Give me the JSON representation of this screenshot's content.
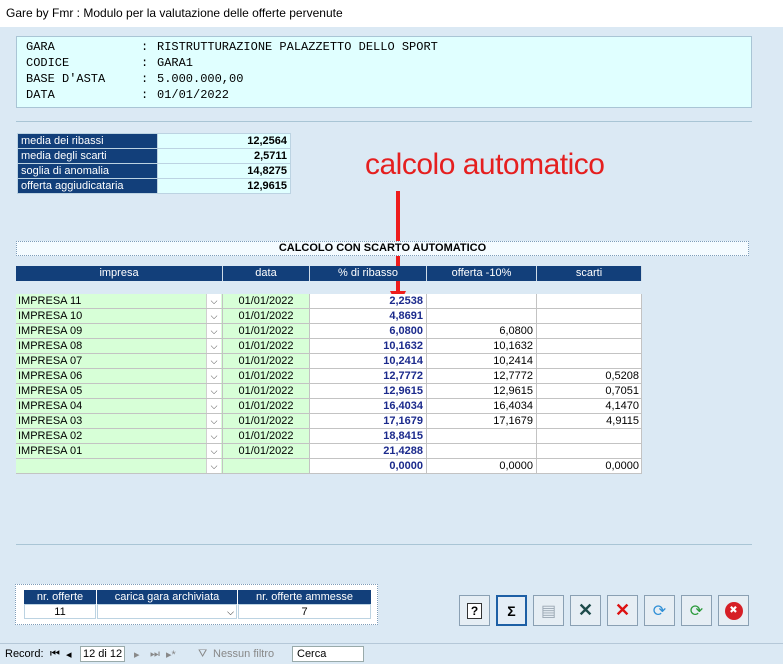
{
  "window": {
    "title": "Gare by Fmr : Modulo per la valutazione delle offerte pervenute"
  },
  "gara": {
    "rows": [
      {
        "key": "GARA",
        "value": "RISTRUTTURAZIONE PALAZZETTO DELLO SPORT"
      },
      {
        "key": "CODICE",
        "value": "GARA1"
      },
      {
        "key": "BASE D'ASTA",
        "value": "5.000.000,00"
      },
      {
        "key": "DATA",
        "value": "01/01/2022"
      }
    ]
  },
  "stats": [
    {
      "label": "media dei ribassi",
      "value": "12,2564"
    },
    {
      "label": "media degli scarti",
      "value": "2,5711"
    },
    {
      "label": "soglia di anomalia",
      "value": "14,8275"
    },
    {
      "label": "offerta aggiudicataria",
      "value": "12,9615"
    }
  ],
  "annotation": {
    "text": "calcolo automatico",
    "color": "#e51f1f"
  },
  "calc_title": "CALCOLO CON SCARTO AUTOMATICO",
  "table": {
    "headers": [
      "impresa",
      "data",
      "% di ribasso",
      "offerta  -10%",
      "scarti"
    ],
    "rows": [
      {
        "impresa": "IMPRESA 11",
        "data": "01/01/2022",
        "ribasso": "2,2538",
        "offerta": "",
        "scarti": ""
      },
      {
        "impresa": "IMPRESA 10",
        "data": "01/01/2022",
        "ribasso": "4,8691",
        "offerta": "",
        "scarti": ""
      },
      {
        "impresa": "IMPRESA 09",
        "data": "01/01/2022",
        "ribasso": "6,0800",
        "offerta": "6,0800",
        "scarti": ""
      },
      {
        "impresa": "IMPRESA 08",
        "data": "01/01/2022",
        "ribasso": "10,1632",
        "offerta": "10,1632",
        "scarti": ""
      },
      {
        "impresa": "IMPRESA 07",
        "data": "01/01/2022",
        "ribasso": "10,2414",
        "offerta": "10,2414",
        "scarti": ""
      },
      {
        "impresa": "IMPRESA 06",
        "data": "01/01/2022",
        "ribasso": "12,7772",
        "offerta": "12,7772",
        "scarti": "0,5208"
      },
      {
        "impresa": "IMPRESA 05",
        "data": "01/01/2022",
        "ribasso": "12,9615",
        "offerta": "12,9615",
        "scarti": "0,7051"
      },
      {
        "impresa": "IMPRESA 04",
        "data": "01/01/2022",
        "ribasso": "16,4034",
        "offerta": "16,4034",
        "scarti": "4,1470"
      },
      {
        "impresa": "IMPRESA 03",
        "data": "01/01/2022",
        "ribasso": "17,1679",
        "offerta": "17,1679",
        "scarti": "4,9115"
      },
      {
        "impresa": "IMPRESA 02",
        "data": "01/01/2022",
        "ribasso": "18,8415",
        "offerta": "",
        "scarti": ""
      },
      {
        "impresa": "IMPRESA 01",
        "data": "01/01/2022",
        "ribasso": "21,4288",
        "offerta": "",
        "scarti": ""
      },
      {
        "impresa": "",
        "data": "",
        "ribasso": "0,0000",
        "offerta": "0,0000",
        "scarti": "0,0000"
      }
    ]
  },
  "footer": {
    "nr_offerte_label": "nr. offerte",
    "nr_offerte_value": "11",
    "carica_label": "carica gara archiviata",
    "carica_value": "",
    "ammesse_label": "nr. offerte ammesse",
    "ammesse_value": "7"
  },
  "toolbar": [
    {
      "name": "help-button",
      "glyph": "?"
    },
    {
      "name": "sum-button",
      "glyph": "Σ"
    },
    {
      "name": "save-button",
      "glyph": "▤"
    },
    {
      "name": "cancel-button",
      "glyph": "✕"
    },
    {
      "name": "delete-button",
      "glyph": "✕"
    },
    {
      "name": "refresh-button",
      "glyph": "⟳"
    },
    {
      "name": "reload-button",
      "glyph": "⟳"
    },
    {
      "name": "close-button",
      "glyph": "✖"
    }
  ],
  "statusbar": {
    "record_label": "Record:",
    "position": "12 di 12",
    "filter": "Nessun filtro",
    "search": "Cerca"
  }
}
